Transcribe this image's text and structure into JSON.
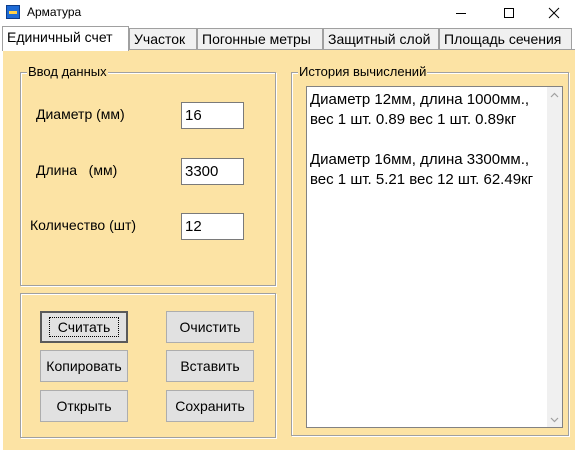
{
  "window": {
    "title": "Арматура",
    "app_icon": "rebar-app-icon"
  },
  "tabs": [
    {
      "label": "Единичный счет",
      "active": true
    },
    {
      "label": "Участок",
      "active": false
    },
    {
      "label": "Погонные метры",
      "active": false
    },
    {
      "label": "Защитный слой",
      "active": false
    },
    {
      "label": "Площадь сечения",
      "active": false
    }
  ],
  "input_group": {
    "title": "Ввод данных",
    "diameter": {
      "label": "Диаметр (мм)",
      "value": "16"
    },
    "length": {
      "label": "Длина   (мм)",
      "value": "3300"
    },
    "quantity": {
      "label": "Количество (шт)",
      "value": "12"
    }
  },
  "buttons": {
    "calculate": "Считать",
    "clear": "Очистить",
    "copy": "Копировать",
    "paste": "Вставить",
    "open": "Открыть",
    "save": "Сохранить"
  },
  "history": {
    "title": "История вычислений",
    "entries": [
      "Диаметр 12мм, длина 1000мм., вес 1 шт. 0.89 вес 1 шт.  0.89кг",
      "Диаметр 16мм, длина 3300мм., вес 1 шт. 5.21 вес 12 шт. 62.49кг"
    ]
  },
  "colors": {
    "panel_background": "#fce3a4",
    "accent_icon": "#1e6bd6"
  }
}
